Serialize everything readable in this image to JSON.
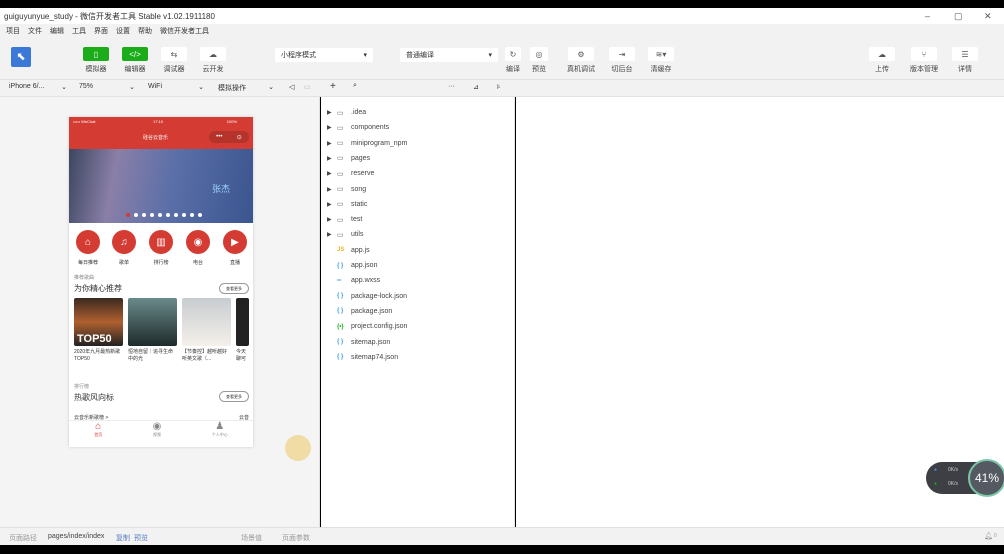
{
  "window": {
    "title": "guiguyunyue_study - 微信开发者工具 Stable v1.02.1911180",
    "minimize": "–",
    "maximize": "▢",
    "close": "✕"
  },
  "menu": [
    "项目",
    "文件",
    "编辑",
    "工具",
    "界面",
    "设置",
    "帮助",
    "微信开发者工具"
  ],
  "toolbar": {
    "left": [
      {
        "label": "模拟器",
        "icon": "phone-icon",
        "glyph": "▯"
      },
      {
        "label": "编辑器",
        "icon": "code-icon",
        "glyph": "</>"
      },
      {
        "label": "调试器",
        "icon": "debug-icon",
        "glyph": "⇆"
      },
      {
        "label": "云开发",
        "icon": "cloud-icon",
        "glyph": "☁"
      }
    ],
    "mode_select": "小程序模式",
    "compile_select": "普通编译",
    "mid": [
      {
        "label": "编译",
        "glyph": "↻"
      },
      {
        "label": "预览",
        "glyph": "◎"
      },
      {
        "label": "真机调试",
        "glyph": "⚙"
      },
      {
        "label": "切后台",
        "glyph": "⇥"
      },
      {
        "label": "清缓存",
        "glyph": "≋▾"
      }
    ],
    "right": [
      {
        "label": "上传",
        "glyph": "☁"
      },
      {
        "label": "版本管理",
        "glyph": "⑂"
      },
      {
        "label": "详情",
        "glyph": "☰"
      }
    ]
  },
  "subbar": {
    "device": "iPhone 6/...",
    "zoom": "75%",
    "network": "WiFi",
    "operation": "模拟操作"
  },
  "phone": {
    "status_left": "••••• WeChat",
    "time": "17:10",
    "battery": "100%",
    "nav_title": "硅谷云音乐",
    "banner_text": "张杰",
    "categories": [
      "每日推荐",
      "歌单",
      "排行榜",
      "电台",
      "直播"
    ],
    "rec_sub": "推荐歌曲",
    "rec_title": "为你精心推荐",
    "more": "查看更多",
    "cards": [
      "2020年九月最热新歌TOP50",
      "恒地自留｜追寻生命中的光",
      "【节奏控】越听越好听英文歌（...",
      "今天聊可"
    ],
    "top50": "TOP50",
    "rank_sub": "排行榜",
    "rank_title": "热歌风向标",
    "rank_item": "云音乐新歌榜 >",
    "rank_item2": "云音",
    "tabs": [
      "首页",
      "视频",
      "个人中心"
    ]
  },
  "tree": {
    "folders": [
      ".idea",
      "components",
      "miniprogram_npm",
      "pages",
      "reserve",
      "song",
      "static",
      "test",
      "utils"
    ],
    "files": [
      {
        "name": "app.js",
        "type": "js"
      },
      {
        "name": "app.json",
        "type": "json"
      },
      {
        "name": "app.wxss",
        "type": "wxss"
      },
      {
        "name": "package-lock.json",
        "type": "json"
      },
      {
        "name": "package.json",
        "type": "json"
      },
      {
        "name": "project.config.json",
        "type": "config"
      },
      {
        "name": "sitemap.json",
        "type": "json"
      },
      {
        "name": "sitemap74.json",
        "type": "json"
      }
    ]
  },
  "status": {
    "label": "页面路径",
    "path": "pages/index/index",
    "copy": "复制",
    "preview": "预览",
    "scene": "场景值",
    "params": "页面参数",
    "bell": "0"
  },
  "perf": {
    "up": "0K/s",
    "down": "0K/s",
    "cpu": "41%"
  },
  "colors": {
    "accent": "#1aad19",
    "brand_red": "#d43c33"
  }
}
